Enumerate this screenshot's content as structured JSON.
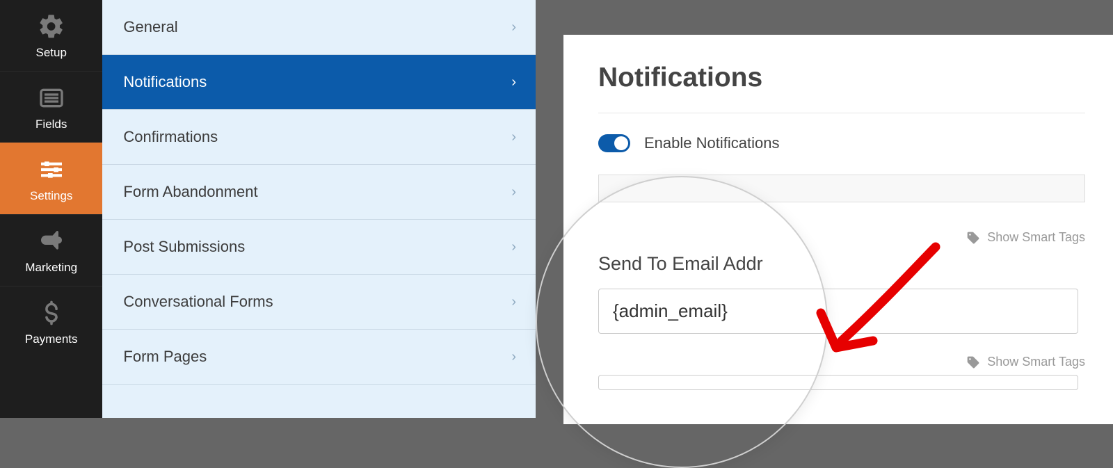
{
  "nav": {
    "items": [
      {
        "label": "Setup"
      },
      {
        "label": "Fields"
      },
      {
        "label": "Settings"
      },
      {
        "label": "Marketing"
      },
      {
        "label": "Payments"
      }
    ]
  },
  "settings": {
    "items": [
      {
        "label": "General"
      },
      {
        "label": "Notifications"
      },
      {
        "label": "Confirmations"
      },
      {
        "label": "Form Abandonment"
      },
      {
        "label": "Post Submissions"
      },
      {
        "label": "Conversational Forms"
      },
      {
        "label": "Form Pages"
      }
    ]
  },
  "main": {
    "title": "Notifications",
    "enable_label": "Enable Notifications",
    "enable_state": true,
    "field_label": "Send To Email Addr",
    "field_value": "{admin_email}",
    "smart_tags_label": "Show Smart Tags"
  },
  "annotation": {
    "arrow_color": "#e60000"
  }
}
